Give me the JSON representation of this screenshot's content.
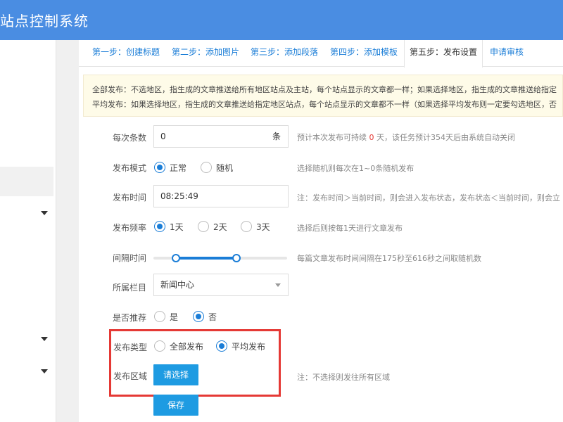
{
  "header": {
    "title": "站点控制系统"
  },
  "steps": [
    {
      "label": "第一步：创建标题",
      "active": false
    },
    {
      "label": "第二步：添加图片",
      "active": false
    },
    {
      "label": "第三步：添加段落",
      "active": false
    },
    {
      "label": "第四步：添加模板",
      "active": false
    },
    {
      "label": "第五步：发布设置",
      "active": true
    },
    {
      "label": "申请审核",
      "active": false
    }
  ],
  "notice": {
    "line1": "全部发布：不选地区，指生成的文章推送给所有地区站点及主站，每个站点显示的文章都一样；如果选择地区，指生成的文章推送给指定",
    "line2": "平均发布：如果选择地区，指生成的文章推送给指定地区站点，每个站点显示的文章都不一样（如果选择平均发布则一定要勾选地区，否"
  },
  "form": {
    "per_count": {
      "label": "每次条数",
      "value": "0",
      "suffix": "条",
      "hint_prefix": "预计本次发布可持续",
      "hint_days": "0",
      "hint_suffix": "天，该任务预计354天后由系统自动关闭"
    },
    "mode": {
      "label": "发布模式",
      "options": [
        {
          "label": "正常",
          "checked": true
        },
        {
          "label": "随机",
          "checked": false
        }
      ],
      "hint": "选择随机则每次在1~0条随机发布"
    },
    "time": {
      "label": "发布时间",
      "value": "08:25:49",
      "hint": "注：发布时间＞当前时间，则会进入发布状态，发布状态＜当前时间，则会立"
    },
    "frequency": {
      "label": "发布频率",
      "options": [
        {
          "label": "1天",
          "checked": true
        },
        {
          "label": "2天",
          "checked": false
        },
        {
          "label": "3天",
          "checked": false
        }
      ],
      "hint": "选择后则按每1天进行文章发布"
    },
    "interval": {
      "label": "间隔时间",
      "min": 175,
      "max": 616,
      "range_start": 0.17,
      "range_end": 0.62,
      "hint": "每篇文章发布时间间隔在175秒至616秒之间取随机数"
    },
    "column": {
      "label": "所属栏目",
      "value": "新闻中心"
    },
    "recommend": {
      "label": "是否推荐",
      "options": [
        {
          "label": "是",
          "checked": false
        },
        {
          "label": "否",
          "checked": true
        }
      ]
    },
    "publish_type": {
      "label": "发布类型",
      "options": [
        {
          "label": "全部发布",
          "checked": false
        },
        {
          "label": "平均发布",
          "checked": true
        }
      ]
    },
    "region": {
      "label": "发布区域",
      "button": "请选择",
      "hint": "注：不选择则发往所有区域"
    },
    "save_button": "保存"
  },
  "colors": {
    "header": "#4a8de2",
    "accent": "#1a7dd7",
    "button": "#1e9be2",
    "highlight": "#e53935",
    "notice_bg": "#fefbe8"
  }
}
